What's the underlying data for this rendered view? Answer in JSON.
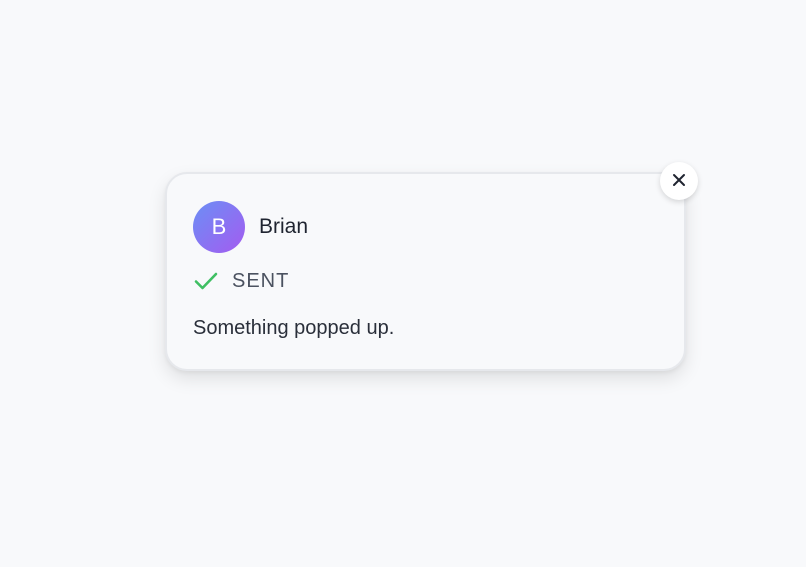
{
  "notification": {
    "avatar_initial": "B",
    "sender_name": "Brian",
    "status": "SENT",
    "status_icon": "check-icon",
    "message": "Something popped up.",
    "close_icon": "close-icon"
  },
  "colors": {
    "background": "#f8f9fb",
    "avatar_gradient_start": "#6b8ff5",
    "avatar_gradient_end": "#a45bf0",
    "check_green": "#3fbf63",
    "text_primary": "#1f2430",
    "text_secondary": "#4b5260"
  }
}
